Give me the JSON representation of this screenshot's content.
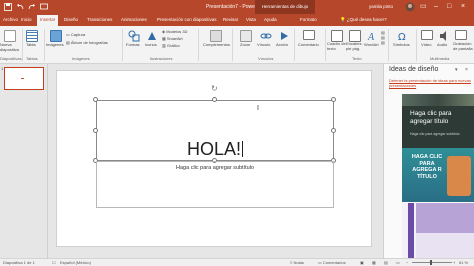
{
  "window": {
    "title": "Presentación7 - PowerPoint",
    "context_tab": "Herramientas de dibujo",
    "user": "yamila pinto"
  },
  "tabs": [
    {
      "label": "Archivo"
    },
    {
      "label": "Inicio"
    },
    {
      "label": "Insertar"
    },
    {
      "label": "Diseño"
    },
    {
      "label": "Transiciones"
    },
    {
      "label": "Animaciones"
    },
    {
      "label": "Presentación con diapositivas"
    },
    {
      "label": "Revisar"
    },
    {
      "label": "Vista"
    },
    {
      "label": "Ayuda"
    },
    {
      "label": "Formato"
    }
  ],
  "tell_me": "¿Qué desea hacer?",
  "ribbon": {
    "nueva_diapositiva": "Nueva diapositiva",
    "tabla": "Tabla",
    "imagenes": "Imágenes",
    "captura": "Captura",
    "album": "Álbum de fotografías",
    "formas": "Formas",
    "iconos": "Iconos",
    "modelos_3d": "Modelos 3D",
    "smartart": "SmartArt",
    "grafico": "Gráfico",
    "complementos": "Complementos",
    "zoom": "Zoom",
    "vinculo": "Vínculo",
    "accion": "Acción",
    "comentario": "Comentario",
    "cuadro_texto": "Cuadro de texto",
    "encabezado": "Encabez. pie pág.",
    "wordart": "WordArt",
    "simbolos": "Símbolos",
    "video": "Vídeo",
    "audio": "Audio",
    "grabacion": "Grabación de pantalla",
    "groups": {
      "diapositivas": "Diapositivas",
      "tablas": "Tablas",
      "imagenes": "Imágenes",
      "ilustraciones": "Ilustraciones",
      "vinculos": "Vínculos",
      "texto": "Texto",
      "multimedia": "Multimedia"
    }
  },
  "thumbnail": {
    "number": "1"
  },
  "slide": {
    "title": "HOLA!",
    "subtitle_placeholder": "Haga clic para agregar subtítulo"
  },
  "design_pane": {
    "title": "Ideas de diseño",
    "link": "Detener la presentación de ideas para nuevas presentaciones",
    "card1_title": "Haga clic para agregar título",
    "card1_sub": "Haga clic para agregar subtítulo",
    "card2_title": "HAGA CLIC PARA AGREGA R TÍTULO"
  },
  "status": {
    "slide": "Diapositiva 1 de 1",
    "language": "Español (México)",
    "notas": "Notas",
    "comentarios": "Comentarios",
    "zoom": "61 %"
  },
  "colors": {
    "accent": "#b7472a",
    "ribbon_bg": "#f3f3f3"
  }
}
